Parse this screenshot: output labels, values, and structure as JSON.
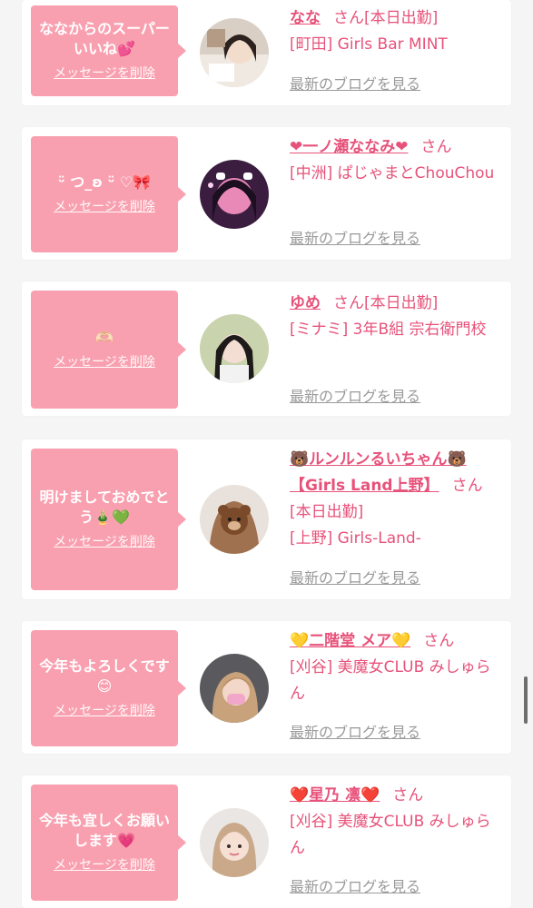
{
  "delete_label": "メッセージを削除",
  "blog_label": "最新のブログを見る",
  "suffix": "さん",
  "accent_color": "#e7527a",
  "bubble_color": "#f9a0b0",
  "messages": [
    {
      "message": "ななからのスーパーいいね💕",
      "name": "なな",
      "suffix_extra": "[本日出勤]",
      "shop": "[町田] Girls Bar MINT",
      "avatar": "photo-avatar"
    },
    {
      "message": "ᵕ̈ つ_ʚ ᵕ̈ ♡🎀",
      "name": "❤︎一ノ瀬ななみ❤︎",
      "suffix_extra": "",
      "shop": "[中洲] ぱじゃまとChouChou",
      "avatar": "photo-avatar"
    },
    {
      "message": "🫶🏻",
      "name": "ゆめ",
      "suffix_extra": "[本日出勤]",
      "shop": "[ミナミ] 3年B組 宗右衛門校",
      "avatar": "photo-avatar"
    },
    {
      "message": "明けましておめでとう🎍💚",
      "name": "🐻ルンルンるいちゃん🐻【Girls Land上野】",
      "suffix_extra": "",
      "status": "[本日出勤]",
      "shop": "[上野] Girls-Land-",
      "avatar": "photo-avatar"
    },
    {
      "message": "今年もよろしくです😊",
      "name": "💛二階堂 メア💛",
      "suffix_extra": "",
      "shop": "[刈谷] 美魔女CLUB みしゅらん",
      "avatar": "photo-avatar"
    },
    {
      "message": "今年も宜しくお願いします💗",
      "name": "❤️星乃 凛❤️",
      "suffix_extra": "",
      "shop": "[刈谷] 美魔女CLUB みしゅらん",
      "avatar": "photo-avatar"
    }
  ]
}
